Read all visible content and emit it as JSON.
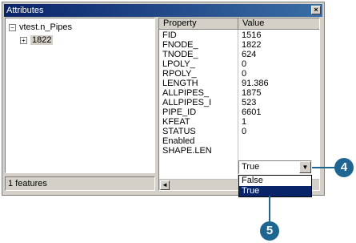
{
  "window": {
    "title": "Attributes",
    "close_label": "×"
  },
  "tree": {
    "root": {
      "toggle": "⊟",
      "label": "vtest.n_Pipes"
    },
    "child": {
      "toggle": "⊞",
      "label": "1822"
    }
  },
  "status": {
    "text": "1 features"
  },
  "grid": {
    "headers": {
      "property": "Property",
      "value": "Value"
    },
    "rows": [
      {
        "k": "FID",
        "v": "1516"
      },
      {
        "k": "FNODE_",
        "v": "1822"
      },
      {
        "k": "TNODE_",
        "v": "624"
      },
      {
        "k": "LPOLY_",
        "v": "0"
      },
      {
        "k": "RPOLY_",
        "v": "0"
      },
      {
        "k": "LENGTH",
        "v": "91.386"
      },
      {
        "k": "ALLPIPES_",
        "v": "1875"
      },
      {
        "k": "ALLPIPES_I",
        "v": "523"
      },
      {
        "k": "PIPE_ID",
        "v": "6601"
      },
      {
        "k": "KFEAT",
        "v": "1"
      },
      {
        "k": "STATUS",
        "v": "0"
      },
      {
        "k": "Enabled",
        "v": ""
      },
      {
        "k": "SHAPE.LEN",
        "v": ""
      }
    ],
    "scroll_left": "◄"
  },
  "combo": {
    "value": "True",
    "arrow": "▼",
    "options": [
      "False",
      "True"
    ]
  },
  "callouts": {
    "step4": "4",
    "step5": "5"
  },
  "colors": {
    "titlebar": "#0a246a",
    "callout": "#1f6591",
    "highlight": "#0a246a"
  }
}
